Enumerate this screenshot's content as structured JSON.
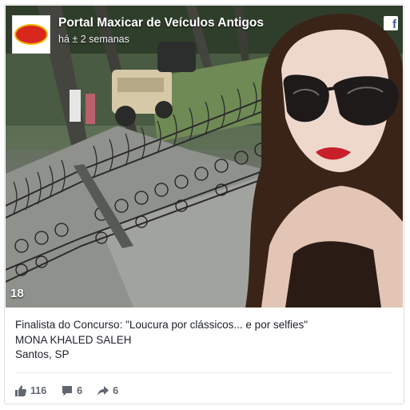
{
  "post": {
    "page_name": "Portal Maxicar de Veículos Antigos",
    "timestamp": "há ± 2 semanas",
    "logo_label": "logo",
    "photo_number": "18",
    "caption": {
      "line1": "Finalista do Concurso: \"Loucura por clássicos... e por selfies\"",
      "line2": "MONA KHALED SALEH",
      "line3": "Santos, SP"
    },
    "actions": {
      "likes": "116",
      "comments": "6",
      "shares": "6"
    },
    "icons": {
      "facebook": "facebook-icon",
      "like": "thumbs-up-icon",
      "comment": "comment-icon",
      "share": "share-arrow-icon"
    },
    "colors": {
      "facebook_blue": "#3b5998",
      "action_gray": "#616770"
    }
  }
}
